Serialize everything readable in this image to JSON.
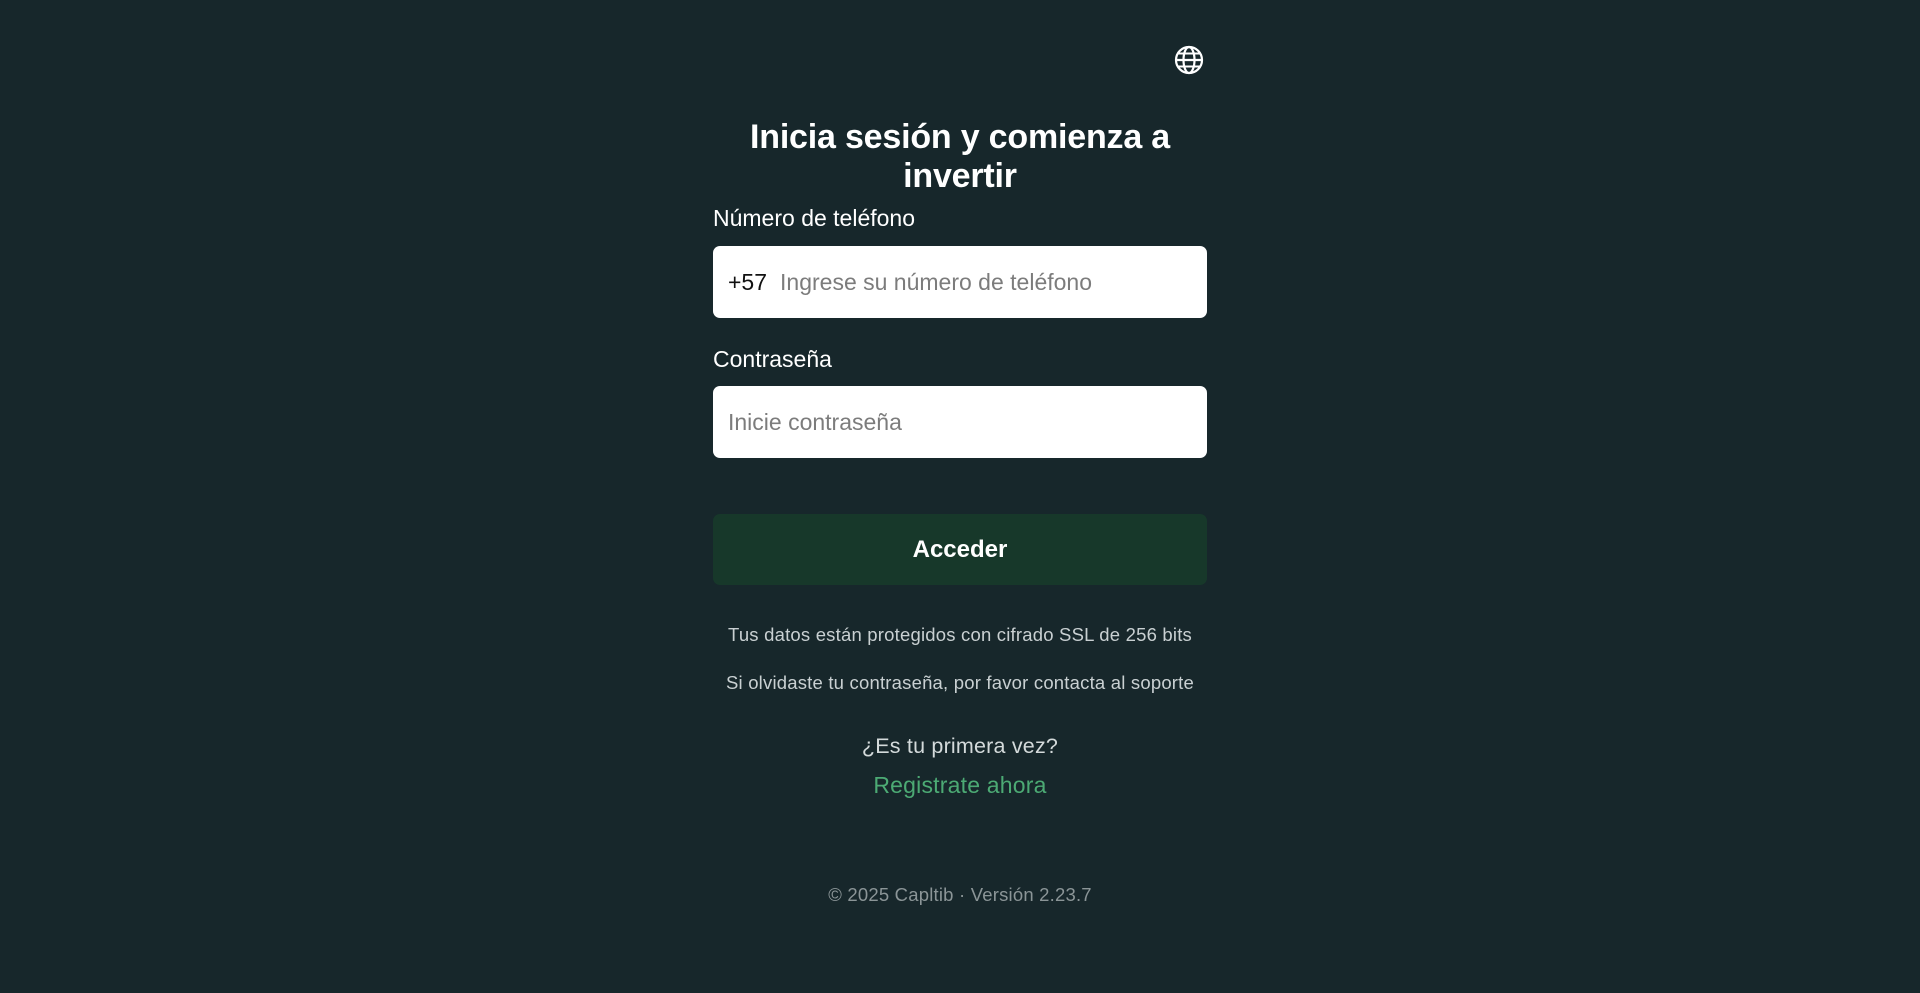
{
  "language_icon": "globe-icon",
  "title": "Inicia sesión y comienza a invertir",
  "phone": {
    "label": "Número de teléfono",
    "prefix": "+57",
    "placeholder": "Ingrese su número de teléfono",
    "value": ""
  },
  "password": {
    "label": "Contraseña",
    "placeholder": "Inicie contraseña",
    "value": ""
  },
  "submit_label": "Acceder",
  "notes": {
    "security": "Tus datos están protegidos con cifrado SSL de 256 bits",
    "forgot": "Si olvidaste tu contraseña, por favor contacta al soporte"
  },
  "signup": {
    "prompt": "¿Es tu primera vez?",
    "link": "Registrate ahora"
  },
  "footer": "© 2025 Capltib · Versión 2.23.7",
  "colors": {
    "background": "#17272b",
    "button": "#17382a",
    "link": "#4caa74"
  }
}
